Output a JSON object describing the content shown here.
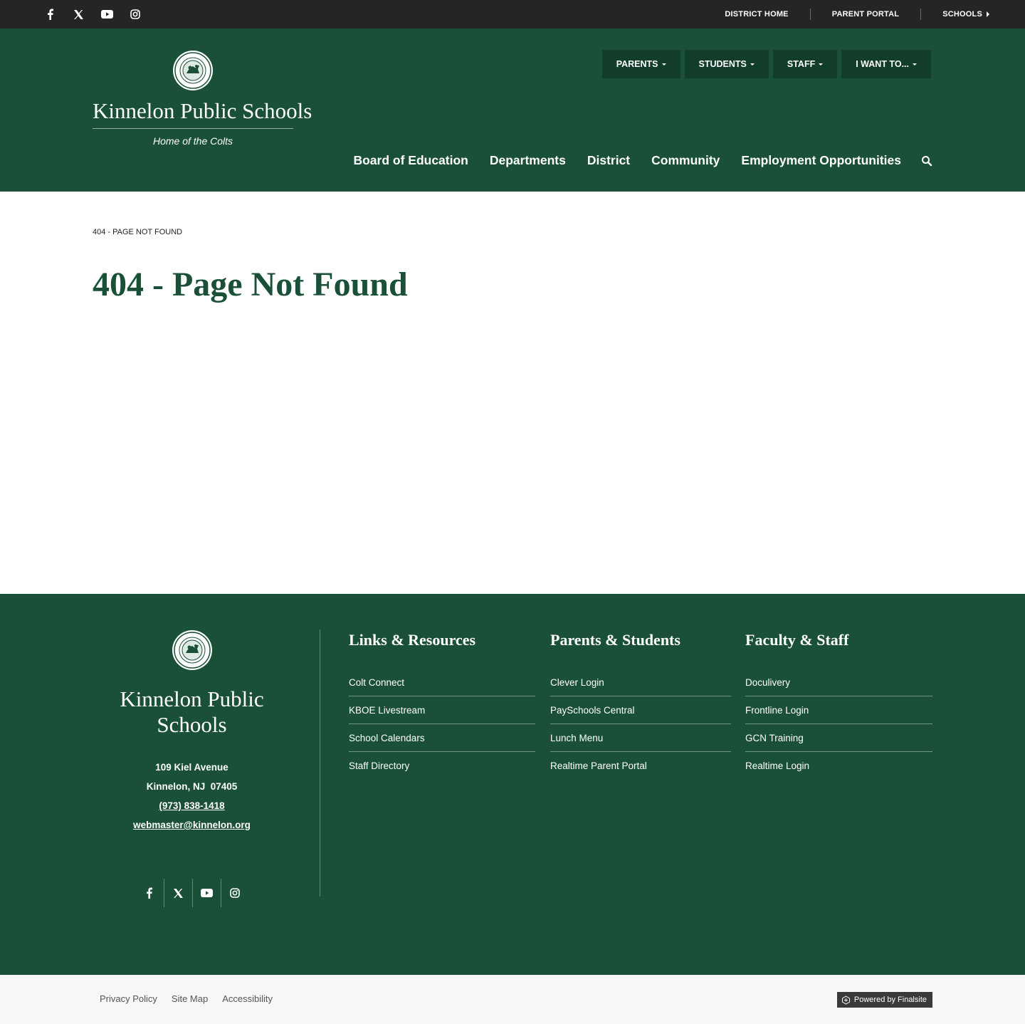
{
  "topbar": {
    "social": [
      {
        "name": "facebook-icon"
      },
      {
        "name": "x-twitter-icon"
      },
      {
        "name": "youtube-icon"
      },
      {
        "name": "instagram-icon"
      }
    ],
    "links": [
      "DISTRICT HOME",
      "PARENT PORTAL",
      "SCHOOLS"
    ]
  },
  "header": {
    "site_name": "Kinnelon Public Schools",
    "tagline": "Home of the Colts",
    "audience_menu": [
      "PARENTS",
      "STUDENTS",
      "STAFF",
      "I WANT TO..."
    ],
    "main_nav": [
      "Board of Education",
      "Departments",
      "District",
      "Community",
      "Employment Opportunities"
    ]
  },
  "content": {
    "breadcrumb": "404 - PAGE NOT FOUND",
    "title": "404 - Page Not Found"
  },
  "footer": {
    "name_line1": "Kinnelon Public",
    "name_line2": "Schools",
    "address_line1": "109 Kiel Avenue",
    "address_line2": "Kinnelon, NJ  07405",
    "phone": "(973) 838-1418",
    "email": "webmaster@kinnelon.org",
    "columns": [
      {
        "heading": "Links & Resources",
        "links": [
          "Colt Connect",
          "KBOE Livestream",
          "School Calendars",
          "Staff Directory"
        ]
      },
      {
        "heading": "Parents & Students",
        "links": [
          "Clever Login",
          "PaySchools Central",
          "Lunch Menu",
          "Realtime Parent Portal"
        ]
      },
      {
        "heading": "Faculty & Staff",
        "links": [
          "Doculivery",
          "Frontline Login",
          "GCN Training",
          "Realtime Login"
        ]
      }
    ]
  },
  "bottom": {
    "legal": [
      "Privacy Policy",
      "Site Map",
      "Accessibility"
    ],
    "powered": "Powered by Finalsite"
  },
  "colors": {
    "brand_green": "#1a5038",
    "dark_green": "#123d2a",
    "topbar": "#252525"
  }
}
